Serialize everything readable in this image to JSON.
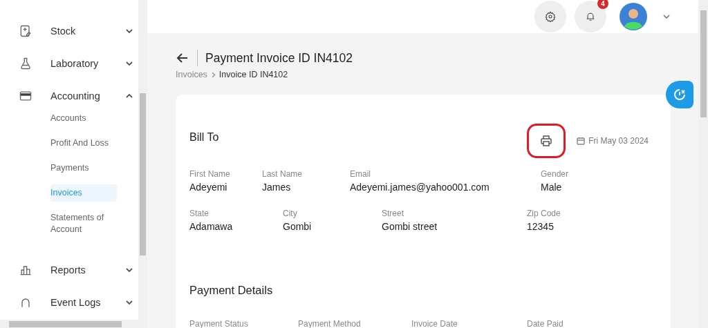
{
  "sidebar": {
    "items": [
      {
        "label": "Stock",
        "expanded": false
      },
      {
        "label": "Laboratory",
        "expanded": false
      },
      {
        "label": "Accounting",
        "expanded": true,
        "children": [
          {
            "label": "Accounts",
            "selected": false
          },
          {
            "label": "Profit And Loss",
            "selected": false
          },
          {
            "label": "Payments",
            "selected": false
          },
          {
            "label": "Invoices",
            "selected": true
          },
          {
            "label": "Statements of Account",
            "selected": false
          }
        ]
      },
      {
        "label": "Reports",
        "expanded": false
      },
      {
        "label": "Event Logs",
        "expanded": false
      }
    ]
  },
  "header": {
    "notification_count": "4"
  },
  "page": {
    "title": "Payment Invoice ID IN4102",
    "breadcrumb": [
      "Invoices",
      "Invoice ID IN4102"
    ]
  },
  "bill_to": {
    "title": "Bill To",
    "print_highlighted": true,
    "date": "Fri May 03 2024",
    "rows": [
      [
        {
          "label": "First Name",
          "value": "Adeyemi"
        },
        {
          "label": "Last Name",
          "value": "James"
        },
        {
          "label": "Email",
          "value": "Adeyemi.james@yahoo001.com"
        },
        {
          "label": "Gender",
          "value": "Male"
        }
      ],
      [
        {
          "label": "State",
          "value": "Adamawa"
        },
        {
          "label": "City",
          "value": "Gombi"
        },
        {
          "label": "Street",
          "value": "Gombi street"
        },
        {
          "label": "Zip Code",
          "value": "12345"
        }
      ]
    ]
  },
  "payment_details": {
    "title": "Payment Details",
    "labels": [
      "Payment Status",
      "Payment Method",
      "Invoice Date",
      "Date Paid"
    ]
  }
}
